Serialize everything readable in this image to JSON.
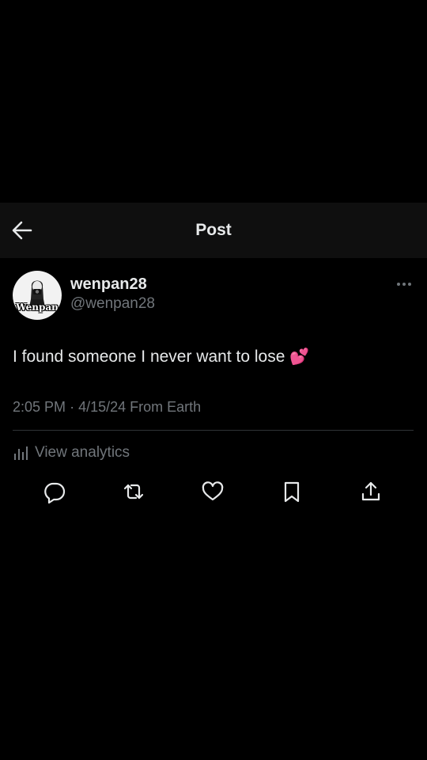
{
  "header": {
    "title": "Post",
    "back_icon": "arrow-left-icon"
  },
  "author": {
    "avatar_text": "Wenpan",
    "display_name": "wenpan28",
    "handle": "@wenpan28"
  },
  "post": {
    "text": "I found someone I never want to lose",
    "emoji": "💕",
    "time": "2:05 PM",
    "separator": "·",
    "date": "4/15/24",
    "source": "From Earth"
  },
  "analytics": {
    "label": "View analytics",
    "icon": "bar-chart-icon"
  },
  "actions": [
    "reply-icon",
    "repost-icon",
    "like-icon",
    "bookmark-icon",
    "share-icon"
  ],
  "colors": {
    "background": "#000000",
    "header_bg": "#0f0f0f",
    "text": "#e7e9ea",
    "secondary": "#71767b",
    "divider": "#2f3336"
  }
}
